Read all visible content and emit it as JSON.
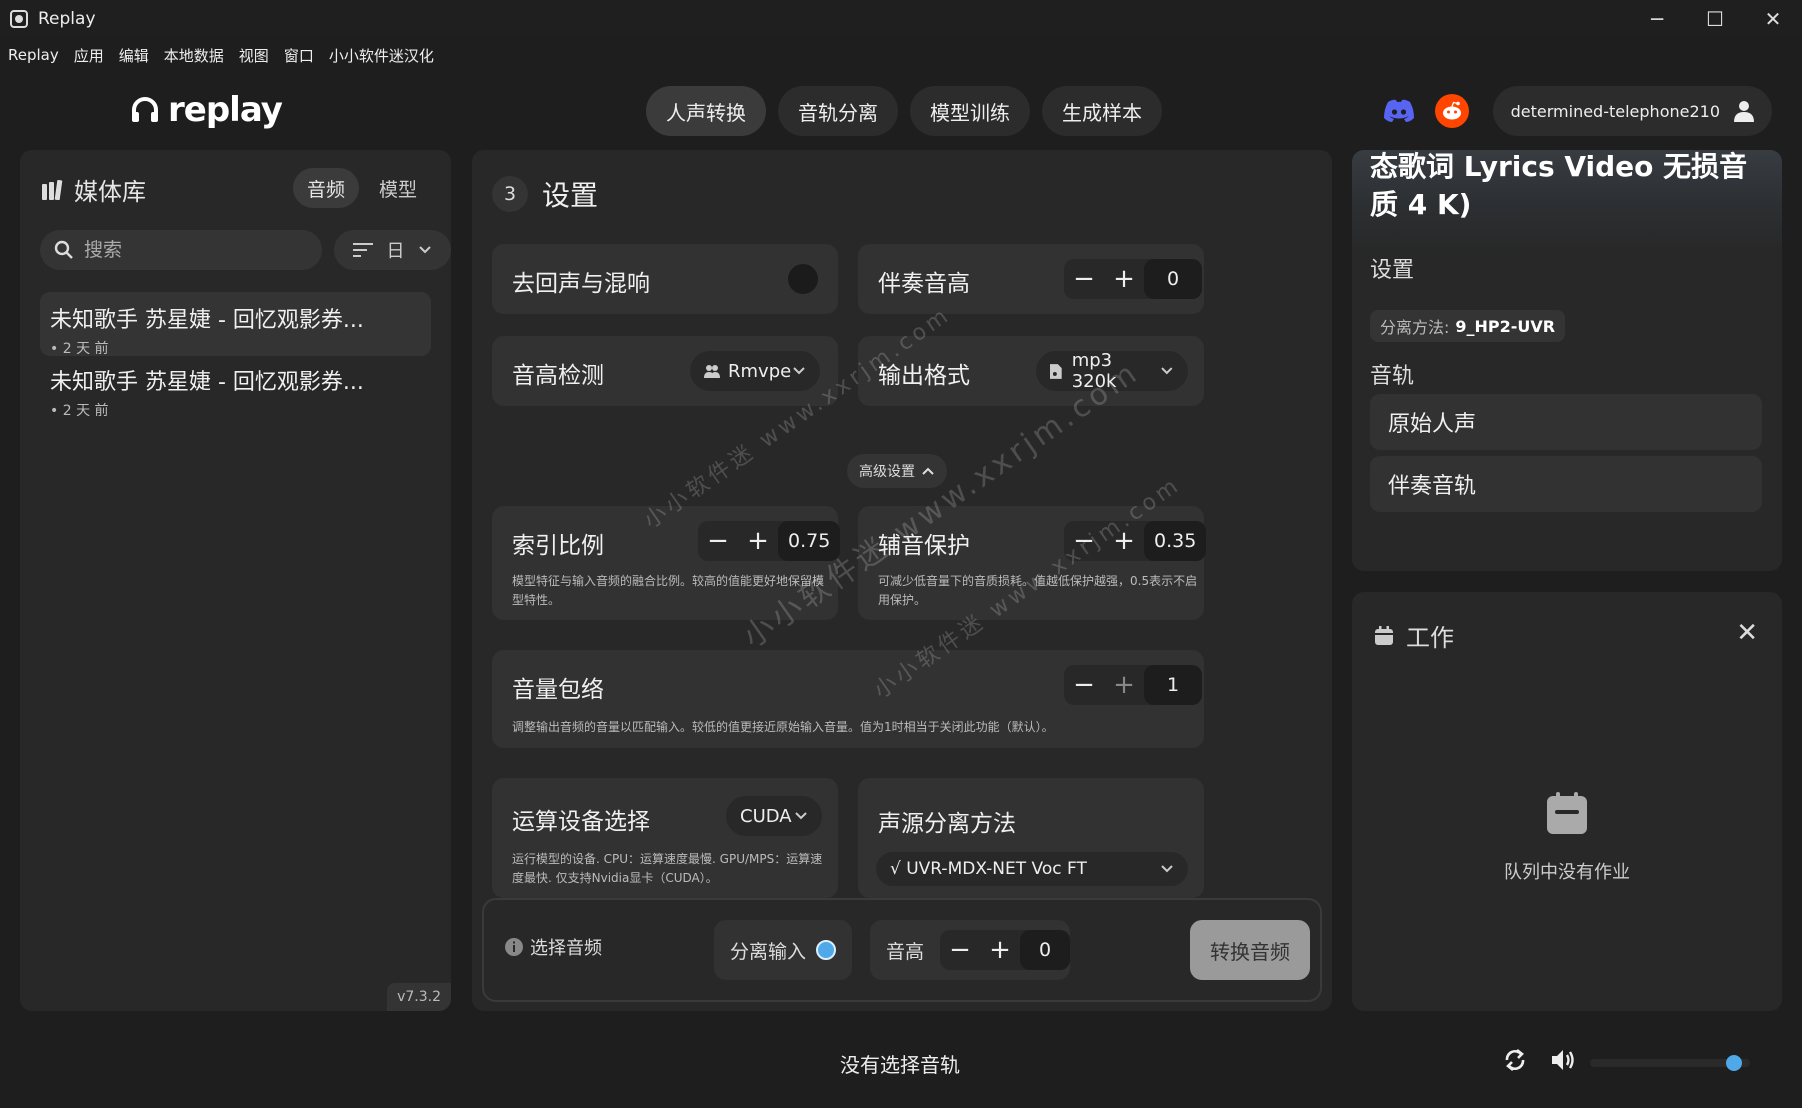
{
  "window": {
    "title": "Replay",
    "controls": [
      "─",
      "☐",
      "✕"
    ]
  },
  "menu": [
    "Replay",
    "应用",
    "编辑",
    "本地数据",
    "视图",
    "窗口",
    "小小软件迷汉化"
  ],
  "header": {
    "logo": "replay",
    "tabs": [
      "人声转换",
      "音轨分离",
      "模型训练",
      "生成样本"
    ],
    "active_tab": 0,
    "username": "determined-telephone210",
    "discord_color": "#5865f2",
    "reddit_color": "#ff4500"
  },
  "library": {
    "title": "媒体库",
    "tabs": [
      "音频",
      "模型"
    ],
    "search_placeholder": "搜索",
    "sort_label": "日",
    "items": [
      {
        "title": "未知歌手 苏星婕 - 回忆观影券...",
        "time": "• 2 天 前"
      },
      {
        "title": "未知歌手 苏星婕 - 回忆观影券...",
        "time": "• 2 天 前"
      }
    ],
    "version": "v7.3.2"
  },
  "settings": {
    "step": "3",
    "title": "设置",
    "echo": {
      "label": "去回声与混响"
    },
    "inst_pitch": {
      "label": "伴奏音高",
      "value": "0"
    },
    "pitch_detect": {
      "label": "音高检测",
      "value": "Rmvpe"
    },
    "output_format": {
      "label": "输出格式",
      "value": "mp3 320k"
    },
    "advanced": "高级设置",
    "index_ratio": {
      "label": "索引比例",
      "value": "0.75",
      "desc": "模型特征与输入音频的融合比例。较高的值能更好地保留模型特性。"
    },
    "consonant": {
      "label": "辅音保护",
      "value": "0.35",
      "desc": "可减少低音量下的音质损耗。值越低保护越强，0.5表示不启用保护。"
    },
    "volume_env": {
      "label": "音量包络",
      "value": "1",
      "desc": "调整输出音频的音量以匹配输入。较低的值更接近原始输入音量。值为1时相当于关闭此功能（默认）。"
    },
    "device": {
      "label": "运算设备选择",
      "value": "CUDA",
      "desc": "运行模型的设备. CPU：运算速度最慢. GPU/MPS：运算速度最快. 仅支持Nvidia显卡（CUDA）。"
    },
    "separation": {
      "label": "声源分离方法",
      "value": "√ UVR-MDX-NET Voc FT"
    }
  },
  "bottom": {
    "hint": "选择音频",
    "split_input": "分离输入",
    "pitch_label": "音高",
    "pitch_value": "0",
    "convert": "转换音频",
    "accent": "#4fa8e8"
  },
  "song_panel": {
    "song_title": "态歌词 Lyrics Video 无损音质 4 K)",
    "settings_label": "设置",
    "method_key": "分离方法:",
    "method_value": "9_HP2-UVR",
    "tracks_label": "音轨",
    "tracks": [
      "原始人声",
      "伴奏音轨"
    ]
  },
  "jobs": {
    "title": "工作",
    "empty": "队列中没有作业"
  },
  "footer": {
    "status": "没有选择音轨",
    "volume": 0.9
  },
  "watermark": [
    "小小软件迷 www.xxrjm.com",
    "小小软件迷 www.xxrjm.com",
    "小小软件迷 www.xxrjm.com"
  ]
}
